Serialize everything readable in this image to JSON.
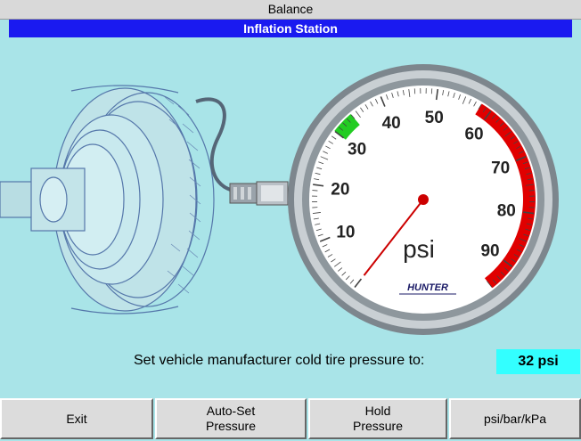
{
  "window": {
    "title": "Balance",
    "subtitle": "Inflation Station"
  },
  "gauge": {
    "unit": "psi",
    "brand": "HUNTER",
    "tick_labels": [
      "10",
      "20",
      "30",
      "40",
      "50",
      "60",
      "70",
      "80",
      "90"
    ],
    "current_value_psi": 0,
    "target_zone_psi": [
      30,
      34
    ],
    "red_zone_psi": [
      58,
      95
    ],
    "colors": {
      "target": "#22cc22",
      "red": "#e00000",
      "needle": "#cc0000"
    }
  },
  "prompt": {
    "label": "Set vehicle manufacturer cold tire pressure to:",
    "value": "32 psi"
  },
  "buttons": {
    "exit": "Exit",
    "auto_set": "Auto-Set\nPressure",
    "hold": "Hold\nPressure",
    "units": "psi/bar/kPa"
  }
}
